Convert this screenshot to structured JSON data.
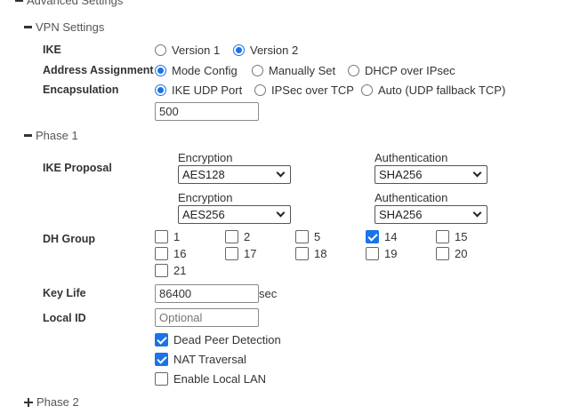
{
  "advanced_settings": {
    "label": "Advanced Settings"
  },
  "vpn_settings": {
    "label": "VPN Settings"
  },
  "ike": {
    "label": "IKE",
    "options": [
      "Version 1",
      "Version 2"
    ],
    "selected": "Version 2"
  },
  "address_assignment": {
    "label": "Address Assignment",
    "options": [
      "Mode Config",
      "Manually Set",
      "DHCP over IPsec"
    ],
    "selected": "Mode Config"
  },
  "encapsulation": {
    "label": "Encapsulation",
    "options": [
      "IKE UDP Port",
      "IPSec over TCP",
      "Auto (UDP fallback TCP)"
    ],
    "selected": "IKE UDP Port",
    "port_value": "500"
  },
  "phase1": {
    "label": "Phase 1",
    "ike_proposal": {
      "label": "IKE Proposal",
      "encryption_label": "Encryption",
      "authentication_label": "Authentication",
      "proposals": [
        {
          "encryption": "AES128",
          "authentication": "SHA256"
        },
        {
          "encryption": "AES256",
          "authentication": "SHA256"
        }
      ]
    },
    "dh_group": {
      "label": "DH Group",
      "options": [
        {
          "value": "1",
          "checked": false
        },
        {
          "value": "2",
          "checked": false
        },
        {
          "value": "5",
          "checked": false
        },
        {
          "value": "14",
          "checked": true
        },
        {
          "value": "15",
          "checked": false
        },
        {
          "value": "16",
          "checked": false
        },
        {
          "value": "17",
          "checked": false
        },
        {
          "value": "18",
          "checked": false
        },
        {
          "value": "19",
          "checked": false
        },
        {
          "value": "20",
          "checked": false
        },
        {
          "value": "21",
          "checked": false
        }
      ]
    },
    "key_life": {
      "label": "Key Life",
      "value": "86400",
      "unit": "sec"
    },
    "local_id": {
      "label": "Local ID",
      "placeholder": "Optional"
    },
    "dead_peer_detection": {
      "label": "Dead Peer Detection",
      "checked": true
    },
    "nat_traversal": {
      "label": "NAT Traversal",
      "checked": true
    },
    "enable_local_lan": {
      "label": "Enable Local LAN",
      "checked": false
    }
  },
  "phase2": {
    "label": "Phase 2"
  },
  "colors": {
    "accent": "#1a73e8"
  }
}
